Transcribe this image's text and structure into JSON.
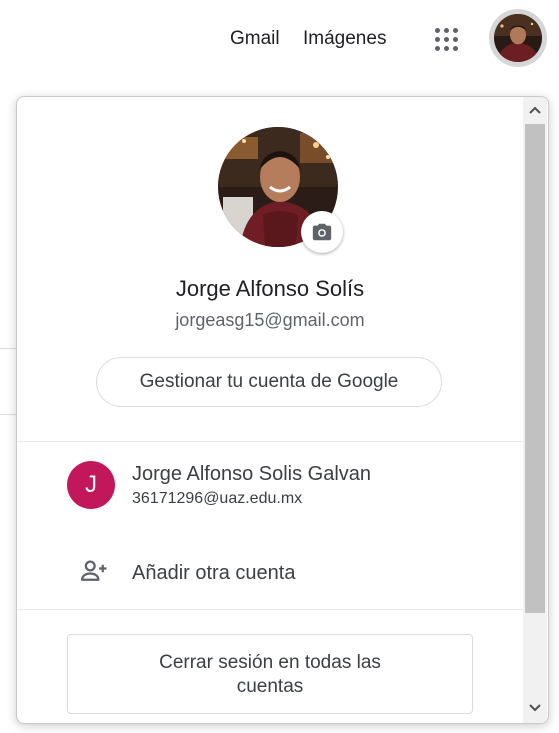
{
  "header": {
    "gmail_label": "Gmail",
    "images_label": "Imágenes"
  },
  "profile": {
    "name": "Jorge Alfonso Solís",
    "email": "jorgeasg15@gmail.com",
    "manage_label": "Gestionar tu cuenta de Google"
  },
  "other_account": {
    "initial": "J",
    "name": "Jorge Alfonso Solis Galvan",
    "email": "36171296@uaz.edu.mx",
    "avatar_color": "#c2185b"
  },
  "add_account_label": "Añadir otra cuenta",
  "signout_label": "Cerrar sesión en todas las cuentas",
  "icons": {
    "apps": "apps-grid-icon",
    "camera": "camera-icon",
    "add_person": "person-add-icon",
    "scroll_up": "chevron-up-icon",
    "scroll_down": "chevron-down-icon"
  }
}
